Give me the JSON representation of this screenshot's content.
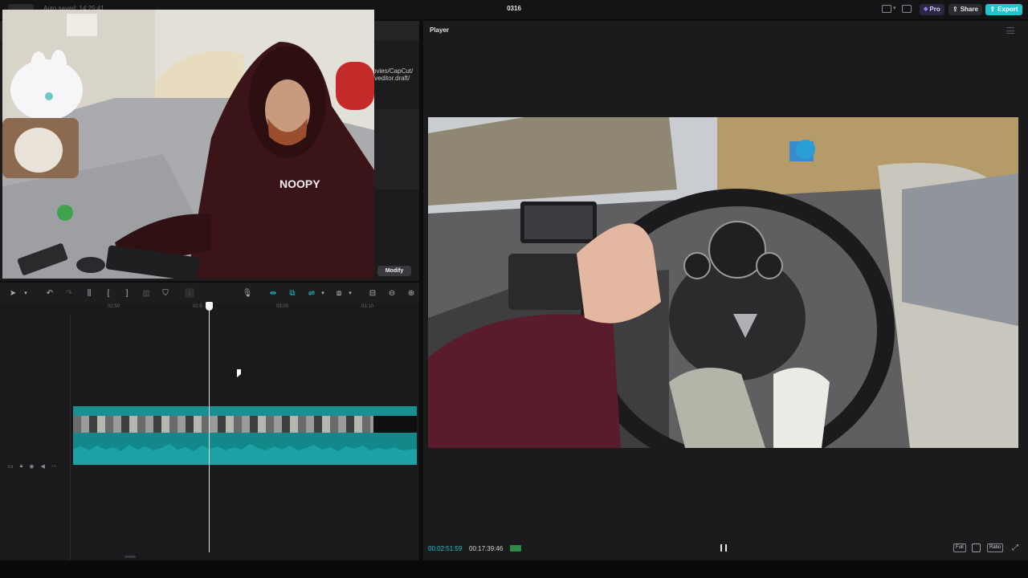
{
  "app": {
    "autosave": "Auto saved: 14:25:41",
    "project_title": "0316"
  },
  "header": {
    "pro_label": "Pro",
    "share_label": "Share",
    "export_label": "Export"
  },
  "media_panel": {
    "path_line1": "ovies/CapCut/",
    "path_line2": "\\veditor.draft/",
    "modify_label": "Modify"
  },
  "timeline": {
    "ruler_ticks": [
      "02:50",
      "02:5",
      "03:00",
      "03:10"
    ]
  },
  "player": {
    "title": "Player",
    "current_time": "00:02:51:59",
    "total_time": "00:17:39:46",
    "full_label": "Full",
    "ratio_label": "Ratio"
  },
  "colors": {
    "accent": "#1fc4cc",
    "clip": "#12888b"
  }
}
